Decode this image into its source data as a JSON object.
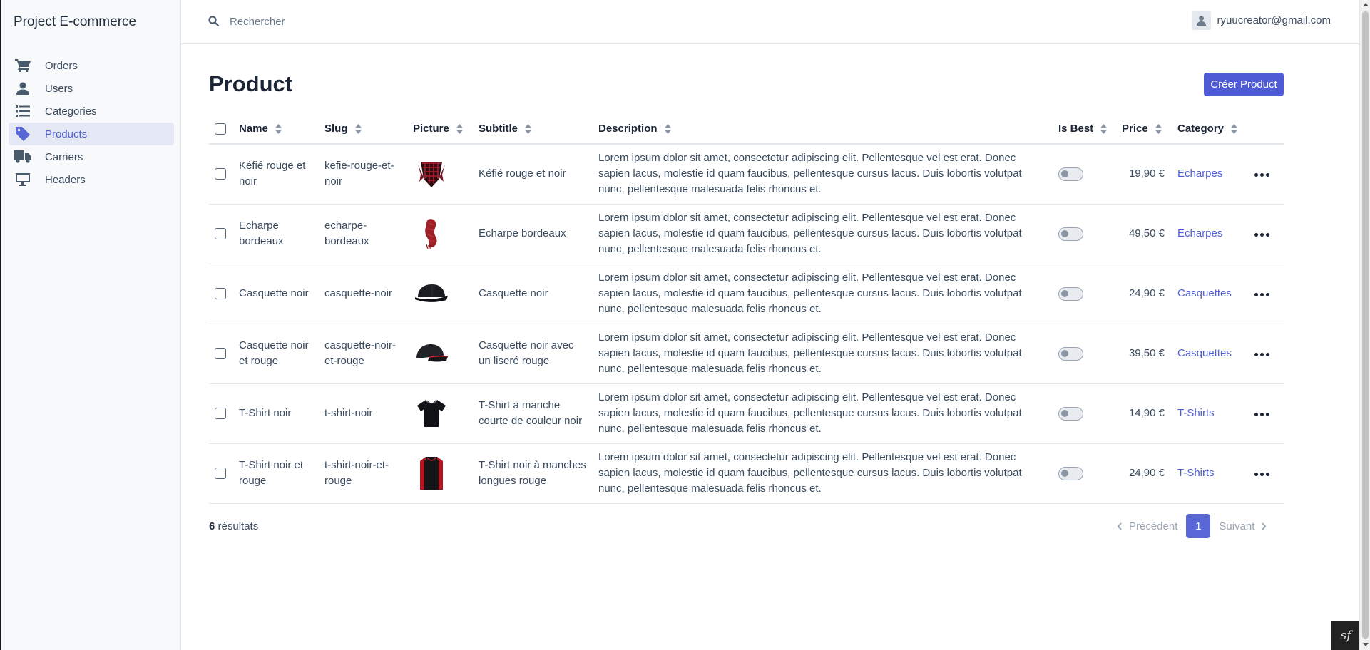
{
  "app": {
    "title": "Project E-commerce"
  },
  "sidebar": {
    "items": [
      {
        "label": "Orders",
        "icon": "cart-icon",
        "active": false
      },
      {
        "label": "Users",
        "icon": "user-icon",
        "active": false
      },
      {
        "label": "Categories",
        "icon": "list-icon",
        "active": false
      },
      {
        "label": "Products",
        "icon": "tag-icon",
        "active": true
      },
      {
        "label": "Carriers",
        "icon": "truck-icon",
        "active": false
      },
      {
        "label": "Headers",
        "icon": "desktop-icon",
        "active": false
      }
    ]
  },
  "topbar": {
    "search_placeholder": "Rechercher",
    "user_email": "ryuucreator@gmail.com"
  },
  "page": {
    "title": "Product",
    "create_label": "Créer Product"
  },
  "table": {
    "columns": {
      "name": "Name",
      "slug": "Slug",
      "picture": "Picture",
      "subtitle": "Subtitle",
      "description": "Description",
      "is_best": "Is Best",
      "price": "Price",
      "category": "Category"
    },
    "rows": [
      {
        "name": "Kéfié rouge et noir",
        "slug": "kefie-rouge-et-noir",
        "picture": "keffiyeh-image",
        "subtitle": "Kéfié rouge et noir",
        "description": "Lorem ipsum dolor sit amet, consectetur adipiscing elit. Pellentesque vel est erat. Donec sapien lacus, molestie id quam faucibus, pellentesque cursus lacus. Duis lobortis volutpat nunc, pellentesque malesuada felis rhoncus et.",
        "is_best": false,
        "price": "19,90 €",
        "category": "Echarpes"
      },
      {
        "name": "Echarpe bordeaux",
        "slug": "echarpe-bordeaux",
        "picture": "scarf-image",
        "subtitle": "Echarpe bordeaux",
        "description": "Lorem ipsum dolor sit amet, consectetur adipiscing elit. Pellentesque vel est erat. Donec sapien lacus, molestie id quam faucibus, pellentesque cursus lacus. Duis lobortis volutpat nunc, pellentesque malesuada felis rhoncus et.",
        "is_best": false,
        "price": "49,50 €",
        "category": "Echarpes"
      },
      {
        "name": "Casquette noir",
        "slug": "casquette-noir",
        "picture": "cap-black-image",
        "subtitle": "Casquette noir",
        "description": "Lorem ipsum dolor sit amet, consectetur adipiscing elit. Pellentesque vel est erat. Donec sapien lacus, molestie id quam faucibus, pellentesque cursus lacus. Duis lobortis volutpat nunc, pellentesque malesuada felis rhoncus et.",
        "is_best": false,
        "price": "24,90 €",
        "category": "Casquettes"
      },
      {
        "name": "Casquette noir et rouge",
        "slug": "casquette-noir-et-rouge",
        "picture": "cap-black-red-image",
        "subtitle": "Casquette noir avec un liseré rouge",
        "description": "Lorem ipsum dolor sit amet, consectetur adipiscing elit. Pellentesque vel est erat. Donec sapien lacus, molestie id quam faucibus, pellentesque cursus lacus. Duis lobortis volutpat nunc, pellentesque malesuada felis rhoncus et.",
        "is_best": false,
        "price": "39,50 €",
        "category": "Casquettes"
      },
      {
        "name": "T-Shirt noir",
        "slug": "t-shirt-noir",
        "picture": "tshirt-black-image",
        "subtitle": "T-Shirt à manche courte de couleur noir",
        "description": "Lorem ipsum dolor sit amet, consectetur adipiscing elit. Pellentesque vel est erat. Donec sapien lacus, molestie id quam faucibus, pellentesque cursus lacus. Duis lobortis volutpat nunc, pellentesque malesuada felis rhoncus et.",
        "is_best": false,
        "price": "14,90 €",
        "category": "T-Shirts"
      },
      {
        "name": "T-Shirt noir et rouge",
        "slug": "t-shirt-noir-et-rouge",
        "picture": "longsleeve-black-red-image",
        "subtitle": "T-Shirt noir à manches longues rouge",
        "description": "Lorem ipsum dolor sit amet, consectetur adipiscing elit. Pellentesque vel est erat. Donec sapien lacus, molestie id quam faucibus, pellentesque cursus lacus. Duis lobortis volutpat nunc, pellentesque malesuada felis rhoncus et.",
        "is_best": false,
        "price": "24,90 €",
        "category": "T-Shirts"
      }
    ]
  },
  "footer": {
    "results_count": "6",
    "results_label": "résultats",
    "prev_label": "Précédent",
    "current_page": "1",
    "next_label": "Suivant"
  },
  "colors": {
    "accent": "#4f5bd5",
    "link": "#4f5fd1",
    "active_nav_bg": "#e3e8f4"
  }
}
